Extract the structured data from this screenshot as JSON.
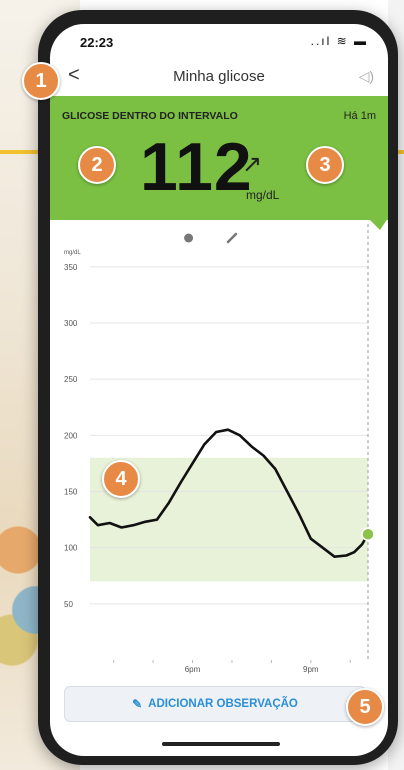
{
  "status_bar": {
    "time": "22:23",
    "icons": "..ıl ≋ ▬"
  },
  "nav": {
    "back_glyph": "<",
    "title": "Minha glicose",
    "speaker_glyph": "◁)"
  },
  "header": {
    "status_label": "GLICOSE DENTRO DO INTERVALO",
    "ago": "Há 1m",
    "reading": "112",
    "trend_glyph": "↗",
    "unit": "mg/dL",
    "background": "#7bc043"
  },
  "chart": {
    "y_unit": "mg/dL",
    "icons": [
      "apple-icon",
      "pen-icon"
    ]
  },
  "chart_data": {
    "type": "line",
    "title": "",
    "xlabel": "",
    "ylabel": "mg/dL",
    "ylim": [
      0,
      365
    ],
    "yticks": [
      50,
      100,
      150,
      200,
      250,
      300,
      350
    ],
    "xticks": [
      {
        "label": "6pm",
        "hour": 18
      },
      {
        "label": "9pm",
        "hour": 21
      }
    ],
    "xlim": [
      15.4,
      22.45
    ],
    "target_range": [
      70,
      180
    ],
    "series": [
      {
        "x": [
          15.4,
          15.6,
          15.9,
          16.2,
          16.5,
          16.8,
          17.1,
          17.4,
          17.7,
          18.0,
          18.3,
          18.6,
          18.9,
          19.2,
          19.5,
          19.8,
          20.1,
          20.4,
          20.7,
          21.0,
          21.3,
          21.6,
          21.9,
          22.1,
          22.3,
          22.45
        ],
        "y": [
          127,
          120,
          122,
          118,
          120,
          123,
          125,
          140,
          158,
          175,
          192,
          203,
          205,
          200,
          190,
          182,
          170,
          150,
          130,
          108,
          100,
          92,
          93,
          96,
          103,
          112
        ],
        "color": "#111111"
      }
    ],
    "current_point": {
      "x": 22.45,
      "y": 112,
      "color": "#8bc34a"
    }
  },
  "actions": {
    "add_note": "ADICIONAR OBSERVAÇÃO",
    "add_note_icon": "pencil-icon"
  },
  "callouts": [
    "1",
    "2",
    "3",
    "4",
    "5"
  ],
  "colors": {
    "callout": "#e68a45",
    "link_blue": "#2a8fd6",
    "band": "#e8f2d8"
  }
}
